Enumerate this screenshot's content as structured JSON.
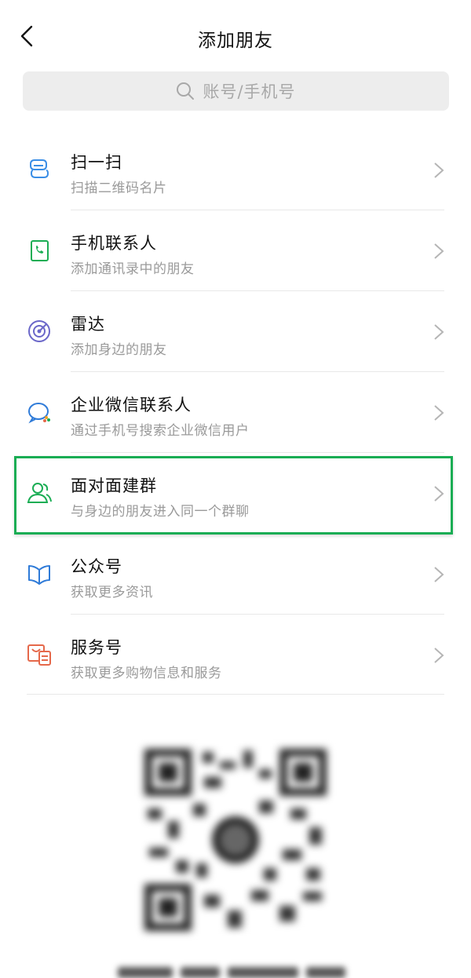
{
  "header": {
    "title": "添加朋友"
  },
  "search": {
    "placeholder": "账号/手机号"
  },
  "menu": [
    {
      "title": "扫一扫",
      "subtitle": "扫描二维码名片",
      "icon": "scan-icon",
      "color": "#3a8ee6"
    },
    {
      "title": "手机联系人",
      "subtitle": "添加通讯录中的朋友",
      "icon": "phone-contact-icon",
      "color": "#1aad54"
    },
    {
      "title": "雷达",
      "subtitle": "添加身边的朋友",
      "icon": "radar-icon",
      "color": "#6b67c9"
    },
    {
      "title": "企业微信联系人",
      "subtitle": "通过手机号搜索企业微信用户",
      "icon": "wecom-icon",
      "color": "#2f7bd8"
    },
    {
      "title": "面对面建群",
      "subtitle": "与身边的朋友进入同一个群聊",
      "icon": "face-to-face-group-icon",
      "color": "#1aad54",
      "highlighted": true
    },
    {
      "title": "公众号",
      "subtitle": "获取更多资讯",
      "icon": "official-account-icon",
      "color": "#2f7bd8"
    },
    {
      "title": "服务号",
      "subtitle": "获取更多购物信息和服务",
      "icon": "service-account-icon",
      "color": "#e5684a"
    }
  ],
  "colors": {
    "highlight": "#1aad54",
    "search_bg": "#ededed",
    "subtitle": "#9a9a9a"
  },
  "qr": {
    "icon": "my-qr-code-icon"
  }
}
